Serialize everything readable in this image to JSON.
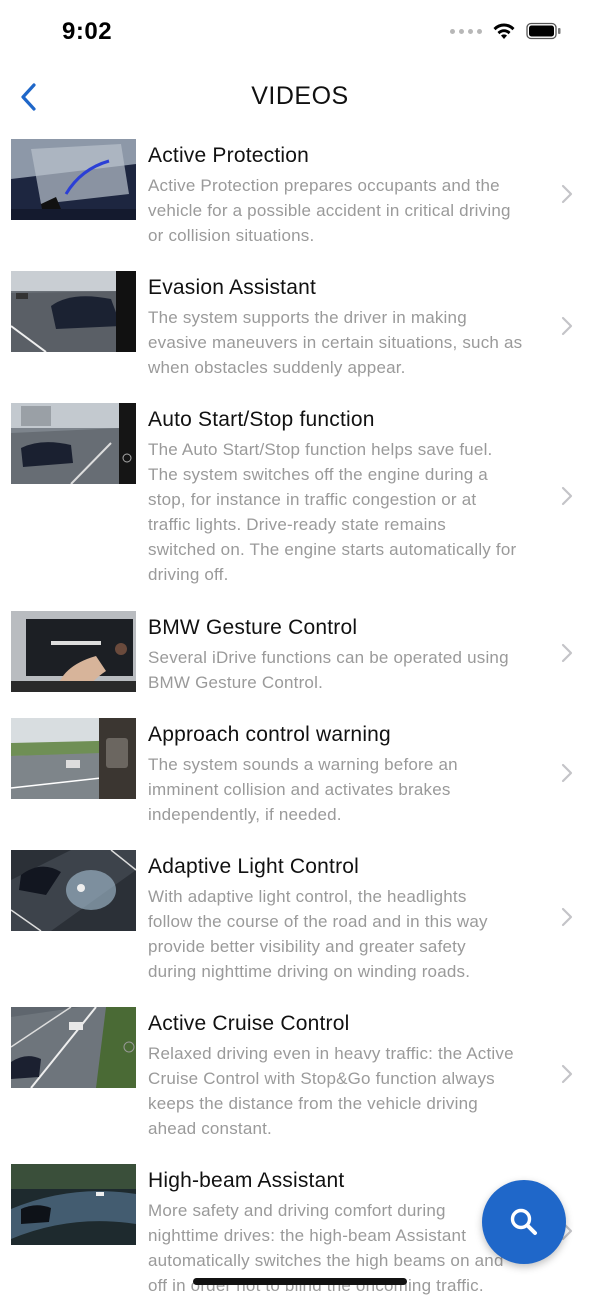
{
  "status": {
    "time": "9:02"
  },
  "nav": {
    "title": "VIDEOS",
    "back_icon": "chevron-left-icon"
  },
  "videos": [
    {
      "title": "Active Protection",
      "desc_lines": [
        "Active Protection prepares occupants and the",
        "vehicle for a possible accident in critical driving",
        "or collision situations."
      ]
    },
    {
      "title": "Evasion Assistant",
      "desc_lines": [
        "The system supports the driver in making",
        "evasive maneuvers in certain situations, such as",
        "when obstacles suddenly appear."
      ]
    },
    {
      "title": "Auto Start/Stop function",
      "desc_lines": [
        "The Auto Start/Stop function helps save fuel.",
        "The system switches off the engine during a",
        "stop, for instance in traffic congestion or at",
        "traffic lights. Drive-ready state remains",
        "switched on. The engine starts automatically for",
        "driving off."
      ]
    },
    {
      "title": "BMW Gesture Control",
      "desc_lines": [
        "Several iDrive functions can be operated using",
        "BMW Gesture Control."
      ]
    },
    {
      "title": "Approach control warning",
      "desc_lines": [
        "The system sounds a warning before an",
        "imminent collision and activates brakes",
        "independently, if needed."
      ]
    },
    {
      "title": "Adaptive Light Control",
      "desc_lines": [
        "With adaptive light control, the headlights",
        "follow the course of the road and in this way",
        "provide better visibility and greater safety",
        "during nighttime driving on winding roads."
      ]
    },
    {
      "title": "Active Cruise Control",
      "desc_lines": [
        "Relaxed driving even in heavy traffic: the Active",
        "Cruise Control with Stop&Go function always",
        "keeps the distance from the vehicle driving",
        "ahead constant."
      ]
    },
    {
      "title": "High-beam Assistant",
      "desc_lines": [
        "More safety and driving comfort during",
        "nighttime drives: the high-beam Assistant",
        "automatically switches the high beams on and",
        "off in order not to blind the oncoming traffic."
      ]
    }
  ],
  "fab": {
    "icon": "search-icon"
  },
  "colors": {
    "accent": "#1f67c9",
    "title_text": "#111111",
    "desc_text": "#9a9a9a",
    "chevron": "#c4c4c8"
  }
}
